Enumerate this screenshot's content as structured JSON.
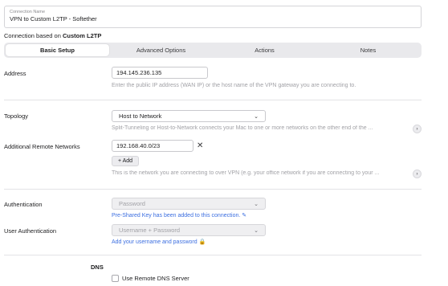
{
  "connection_name": {
    "label": "Connection Name",
    "value": "VPN to Custom L2TP - Softether"
  },
  "based_on": {
    "prefix": "Connection based on",
    "type": "Custom L2TP"
  },
  "tabs": [
    {
      "label": "Basic Setup",
      "active": true
    },
    {
      "label": "Advanced Options",
      "active": false
    },
    {
      "label": "Actions",
      "active": false
    },
    {
      "label": "Notes",
      "active": false
    }
  ],
  "address": {
    "label": "Address",
    "value": "194.145.236.135",
    "hint": "Enter the public IP address (WAN IP) or the host name of the VPN gateway you are connecting to."
  },
  "topology": {
    "label": "Topology",
    "selected": "Host to Network",
    "hint": "Split-Tunneling or Host-to-Network connects your Mac to one or more networks on the other end of the ..."
  },
  "remote_networks": {
    "label": "Additional Remote Networks",
    "value": "192.168.40.0/23",
    "clear_icon": "close-icon",
    "add_label": "+ Add",
    "hint": "This is the network you are connecting to over VPN (e.g. your office network if you are connecting to your ..."
  },
  "authentication": {
    "label": "Authentication",
    "selected": "Password",
    "link": "Pre-Shared Key has been added to this connection."
  },
  "user_authentication": {
    "label": "User Authentication",
    "selected": "Username + Password",
    "link": "Add your username and password"
  },
  "dns": {
    "label": "DNS",
    "checkbox_label": "Use Remote DNS Server",
    "checked": false
  },
  "colors": {
    "accent_link": "#3b6ee0",
    "tab_bg": "#e9e9ec"
  }
}
